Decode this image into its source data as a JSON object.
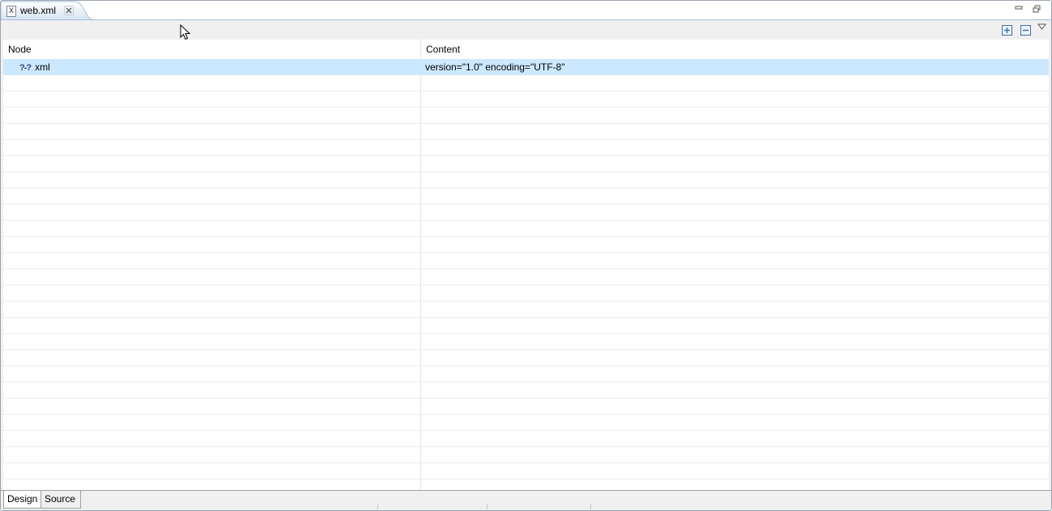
{
  "editor_tab": {
    "icon": "xml-file-icon",
    "icon_glyph": "X",
    "label": "web.xml"
  },
  "toolbar": {
    "expand_icon": "expand-all-icon",
    "collapse_icon": "collapse-all-icon",
    "menu_icon": "view-menu-icon"
  },
  "table": {
    "headers": {
      "node": "Node",
      "content": "Content"
    },
    "rows": [
      {
        "icon": "processing-instruction-icon",
        "icon_glyph": "?-?",
        "node": "xml",
        "content": "version=\"1.0\" encoding=\"UTF-8\"",
        "selected": true
      }
    ]
  },
  "bottom_tabs": [
    {
      "label": "Design",
      "active": true
    },
    {
      "label": "Source",
      "active": false
    }
  ],
  "colors": {
    "selection": "#cce8ff",
    "frame_border": "#9aa5b1",
    "tab_fill": "#dce7f5"
  }
}
